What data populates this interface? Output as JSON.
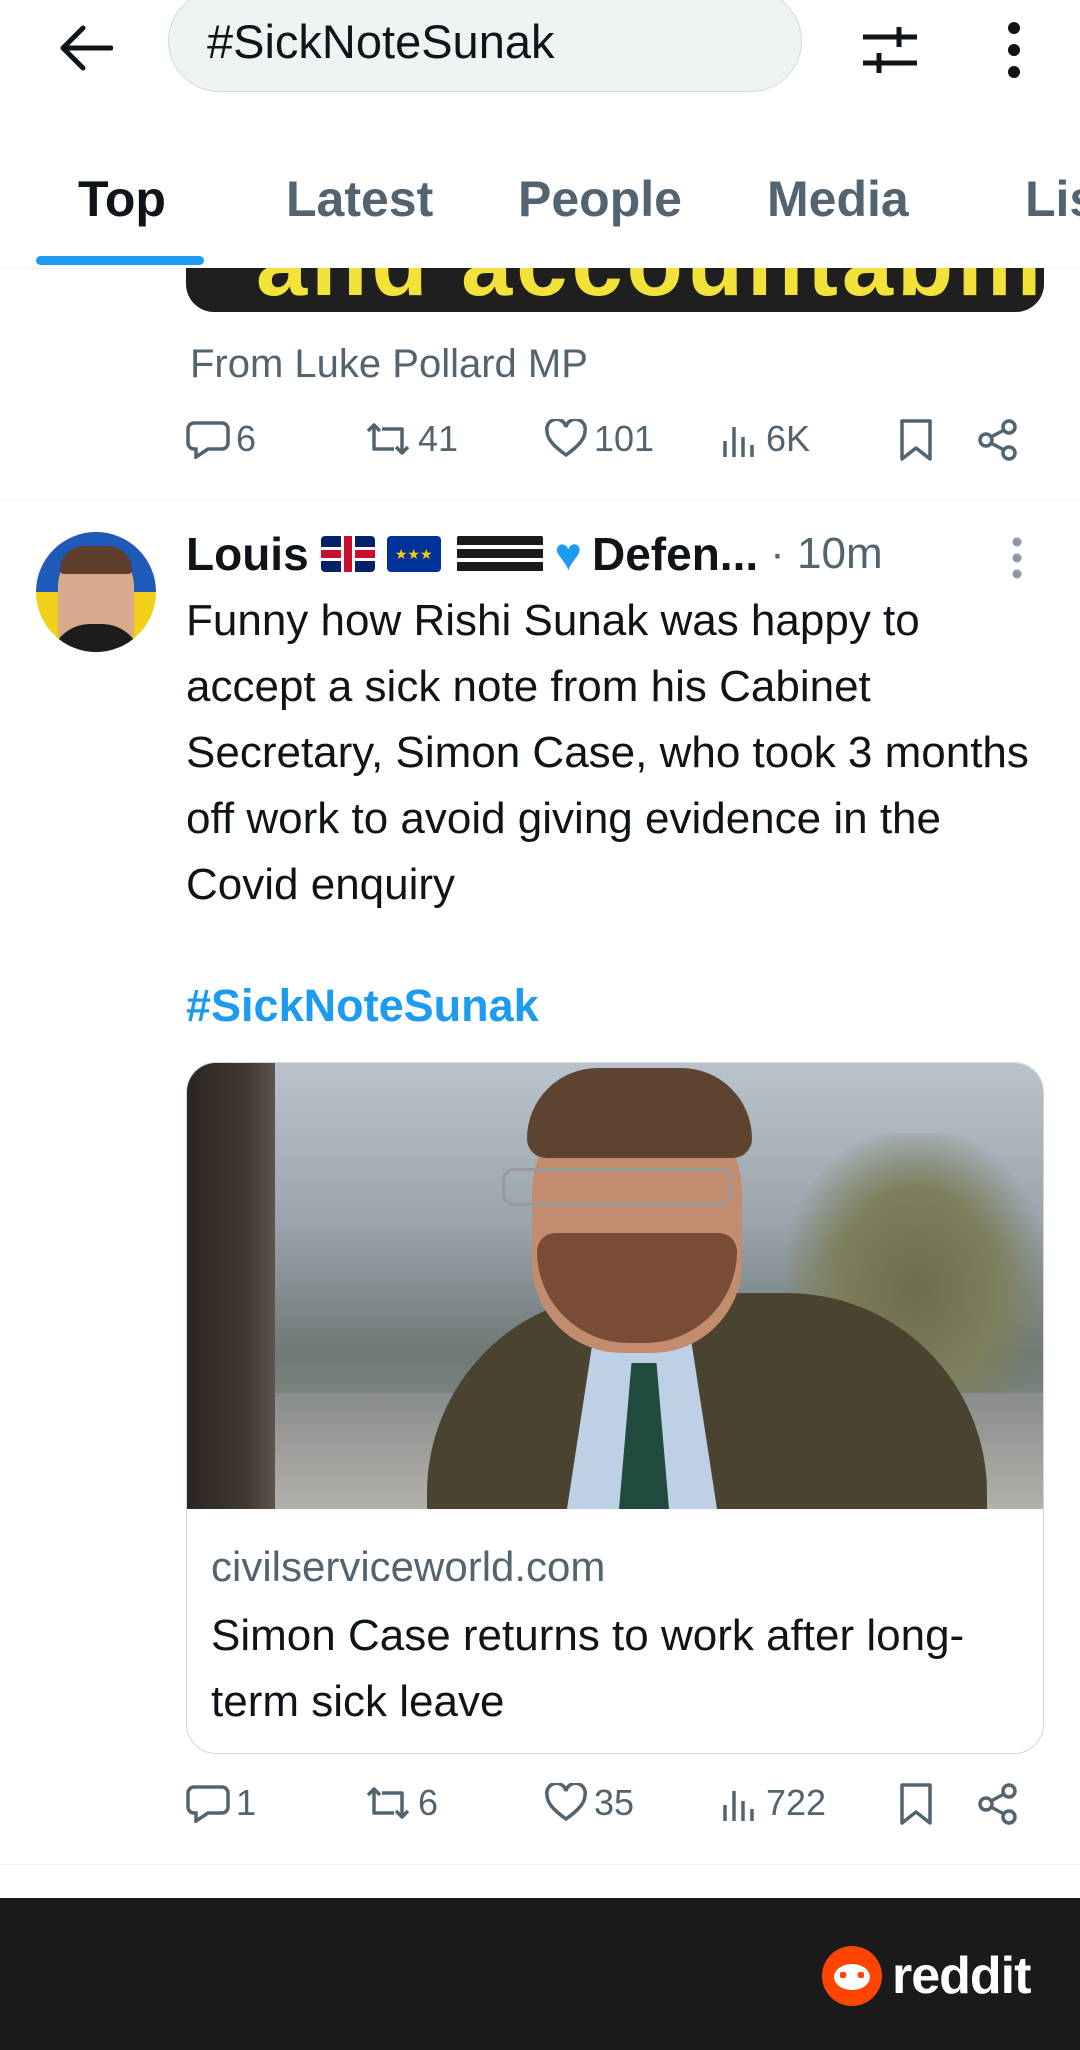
{
  "search": {
    "query": "#SickNoteSunak"
  },
  "tabs": [
    {
      "label": "Top",
      "active": true
    },
    {
      "label": "Latest",
      "active": false
    },
    {
      "label": "People",
      "active": false
    },
    {
      "label": "Media",
      "active": false
    },
    {
      "label": "Lis",
      "active": false
    }
  ],
  "prev_tweet": {
    "media_caption": "and accountability",
    "source": "From Luke Pollard MP",
    "replies": "6",
    "retweets": "41",
    "likes": "101",
    "views": "6K"
  },
  "tweet": {
    "author": "Louis",
    "author_suffix": "Defen...",
    "time": "· 10m",
    "text": "Funny how Rishi Sunak was happy to accept a sick note from his Cabinet Secretary, Simon Case, who took 3 months off work to avoid giving evidence in the Covid enquiry",
    "hashtag": "#SickNoteSunak",
    "card": {
      "domain": "civilserviceworld.com",
      "title": "Simon Case returns to work after long-term sick leave"
    },
    "replies": "1",
    "retweets": "6",
    "likes": "35",
    "views": "722"
  },
  "branding": {
    "reddit": "reddit"
  },
  "colors": {
    "accent": "#1d9bf0",
    "muted": "#536471",
    "text": "#0f1419",
    "reddit_orange": "#ff4500"
  }
}
